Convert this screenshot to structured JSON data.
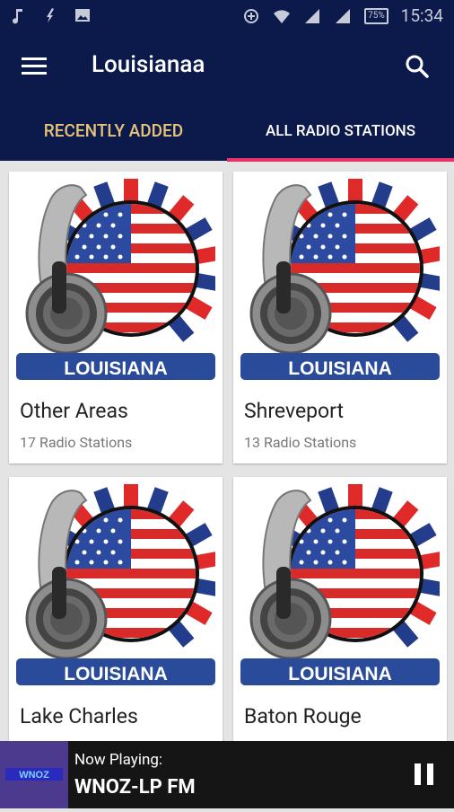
{
  "status_bar": {
    "time": "15:34",
    "battery": "75%"
  },
  "toolbar": {
    "title": "Louisianaa"
  },
  "tabs": [
    {
      "label": "RECENTLY ADDED"
    },
    {
      "label": "ALL RADIO STATIONS"
    }
  ],
  "cards": [
    {
      "name": "Other Areas",
      "count": "17 Radio Stations",
      "banner": "LOUISIANA"
    },
    {
      "name": "Shreveport",
      "count": "13 Radio Stations",
      "banner": "LOUISIANA"
    },
    {
      "name": "Lake Charles",
      "count": "",
      "banner": "LOUISIANA"
    },
    {
      "name": "Baton Rouge",
      "count": "",
      "banner": "LOUISIANA"
    }
  ],
  "player": {
    "now_playing_label": "Now Playing:",
    "station": "WNOZ-LP FM",
    "thumb_text": "WNOZ"
  },
  "colors": {
    "appbar": "#0b1a4a",
    "tab_active": "#e7c27a",
    "indicator": "#e8316a"
  }
}
